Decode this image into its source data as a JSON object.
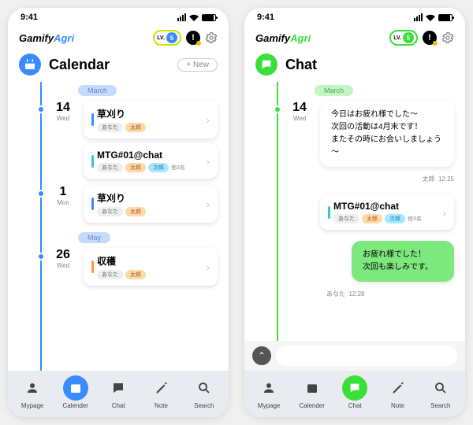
{
  "status": {
    "time": "9:41"
  },
  "brand": {
    "part1": "Gamify",
    "part2": "Agri"
  },
  "header": {
    "level_prefix": "LV.",
    "level": "5"
  },
  "calendar": {
    "title": "Calendar",
    "new_btn": "+ New",
    "months": [
      "March",
      "May"
    ],
    "days": [
      {
        "num": "14",
        "dow": "Wed"
      },
      {
        "num": "1",
        "dow": "Mon"
      },
      {
        "num": "26",
        "dow": "Wed"
      }
    ],
    "events": [
      {
        "title": "草刈り",
        "tags": {
          "you": "あなた",
          "taro": "太郎"
        }
      },
      {
        "title": "MTG#01@chat",
        "tags": {
          "you": "あなた",
          "taro": "太郎",
          "jiro": "次郎",
          "more": "他3名"
        }
      },
      {
        "title": "草刈り",
        "tags": {
          "you": "あなた",
          "taro": "太郎"
        }
      },
      {
        "title": "収穫",
        "tags": {
          "you": "あなた",
          "taro": "太郎"
        }
      }
    ]
  },
  "chat": {
    "title": "Chat",
    "month": "March",
    "day": {
      "num": "14",
      "dow": "Wed"
    },
    "msg_in": {
      "l1": "今日はお疲れ様でした～",
      "l2": "次回の活動は4月末です！",
      "l3": "またその時にお会いしましょう～",
      "name": "太郎",
      "time": "12:25"
    },
    "event": {
      "title": "MTG#01@chat",
      "tags": {
        "you": "あなた",
        "taro": "太郎",
        "jiro": "次郎",
        "more": "他3名"
      }
    },
    "msg_out": {
      "l1": "お疲れ様でした！",
      "l2": "次回も楽しみです。",
      "name": "あなた",
      "time": "12:28"
    }
  },
  "nav": {
    "mypage": "Mypage",
    "calendar": "Calender",
    "chat": "Chat",
    "note": "Note",
    "search": "Search"
  }
}
